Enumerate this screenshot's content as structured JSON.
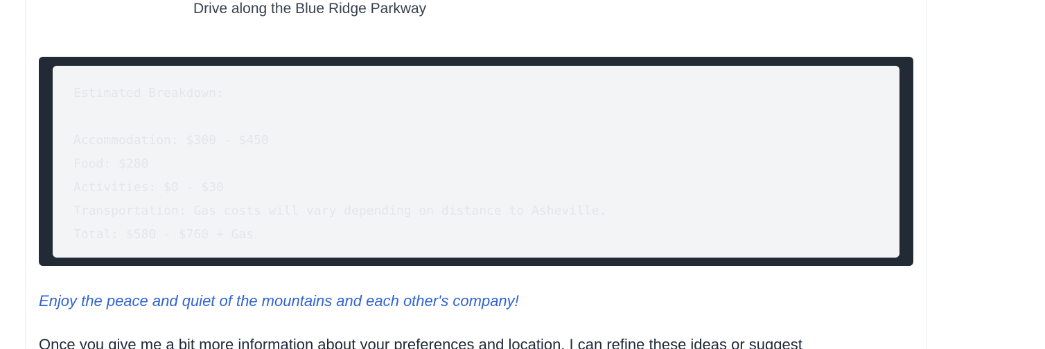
{
  "itinerary": {
    "list_item": "Drive along the Blue Ridge Parkway"
  },
  "code_block": {
    "lines": [
      "Estimated Breakdown:",
      "",
      "Accommodation: $300 - $450",
      "Food: $280",
      "Activities: $0 - $30",
      "Transportation: Gas costs will vary depending on distance to Asheville.",
      "Total: $580 - $760 + Gas"
    ]
  },
  "note": {
    "italic_text": "Enjoy the peace and quiet of the mountains and each other's company!"
  },
  "paragraph": {
    "text": "Once you give me a bit more information about your preferences and location, I can refine these ideas or suggest"
  },
  "colors": {
    "code_frame": "#222a36",
    "code_background": "#f3f4f6",
    "code_text": "#e4e6ea",
    "italic_accent": "#2f63d4"
  }
}
